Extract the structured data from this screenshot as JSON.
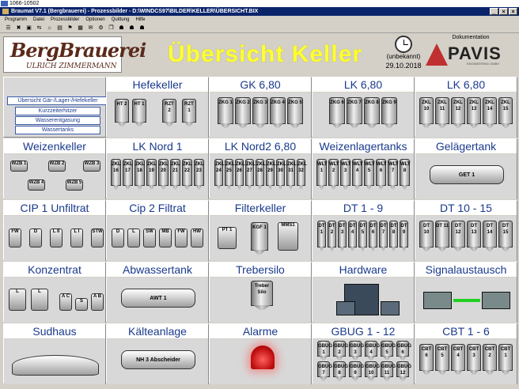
{
  "window": {
    "outer_title": "1066-10502",
    "title": "Braumat V7.1 (Bergbrauerei) - Prozessbilder - D:\\WINDCS97\\BILDER\\KELLER\\ÜBERSICHT.BIX",
    "controls": [
      "_",
      "×",
      "×"
    ]
  },
  "menu": [
    "Programm",
    "Datei",
    "Prozessbilder",
    "Optionen",
    "Quittung",
    "Hilfe"
  ],
  "toolbar_icons": [
    "☰",
    "✖",
    "▣",
    "⇆",
    "⌂",
    "▤",
    "⚑",
    "▦",
    "✉",
    "⚙",
    "❐",
    "☗",
    "☗",
    "☗"
  ],
  "header": {
    "logo_main": "BergBrauerei",
    "logo_sub": "ULRICH ZIMMERMANN",
    "page_title": "Übersicht Keller",
    "clock_label": "(unbekannt)",
    "date": "29.10.2018",
    "doc_label": "Dokumentation",
    "brand": "PAVIS",
    "brand_sub": "ENGINEERING GMBH"
  },
  "nav_buttons": [
    "Übersicht Gär-/Lager-/Hefekeller",
    "Kurzzeiterhitzer",
    "Wasserentgasung",
    "Wassertanks"
  ],
  "cells": {
    "hefekeller": {
      "title": "Hefekeller",
      "tanks": [
        "HT 2",
        "HT 1",
        "RZT 2",
        "RZT 1"
      ]
    },
    "gk": {
      "title": "GK 6,80",
      "tanks": [
        "ZKG 1",
        "ZKG 2",
        "ZKG 3",
        "ZKG 4",
        "ZKG 5"
      ]
    },
    "lk1": {
      "title": "LK 6,80",
      "tanks": [
        "ZKG 6",
        "ZKG 7",
        "ZKG 8",
        "ZKG 9"
      ]
    },
    "lk2": {
      "title": "LK 6,80",
      "tanks": [
        "ZKL 10",
        "ZKL 11",
        "ZKL 12",
        "ZKL 13",
        "ZKL 14",
        "ZKL 15"
      ]
    },
    "weizenkeller": {
      "title": "Weizenkeller",
      "tanks": [
        "WZB 1",
        "WZB 2",
        "WZB 3",
        "WZB 4",
        "WZB 5"
      ]
    },
    "lknord1": {
      "title": "LK Nord 1",
      "tanks": [
        "ZKL 16",
        "ZKL 17",
        "ZKL 18",
        "ZKL 19",
        "ZKL 20",
        "ZKL 21",
        "ZKL 22",
        "ZKL 23"
      ]
    },
    "lknord2": {
      "title": "LK Nord2  6,80",
      "tanks": [
        "ZKL 24",
        "ZKL 25",
        "ZKL 26",
        "ZKL 27",
        "ZKL 28",
        "ZKL 29",
        "ZKL 30",
        "ZKL 31",
        "ZKL 32"
      ]
    },
    "weizenlager": {
      "title": "Weizenlagertanks",
      "tanks": [
        "WLT 1",
        "WLT 2",
        "WLT 3",
        "WLT 4",
        "WLT 5",
        "WLT 6",
        "WLT 7",
        "WLT 8"
      ]
    },
    "gelaeger": {
      "title": "Gelägertank",
      "tanks": [
        "GET 1"
      ]
    },
    "cip1": {
      "title": "CIP 1 Unfiltrat",
      "tanks": [
        "FW",
        "D",
        "L II",
        "L I",
        "STW"
      ]
    },
    "cip2": {
      "title": "Cip 2 Filtrat",
      "tanks": [
        "D",
        "L",
        "SW",
        "MB",
        "FW",
        "HW"
      ]
    },
    "filterkeller": {
      "title": "Filterkeller",
      "tanks": [
        "PT 1",
        "KGF 1",
        "MMS1"
      ]
    },
    "dt19": {
      "title": "DT 1 - 9",
      "tanks": [
        "DT 1",
        "DT 2",
        "DT 3",
        "DT 4",
        "DT 5",
        "DT 6",
        "DT 7",
        "DT 8",
        "DT 9"
      ]
    },
    "dt1015": {
      "title": "DT 10 - 15",
      "tanks": [
        "DT 10",
        "DT 11",
        "DT 12",
        "DT 13",
        "DT 14",
        "DT 15"
      ]
    },
    "konzentrat": {
      "title": "Konzentrat",
      "tanks": [
        "L",
        "L",
        "A C",
        "S",
        "A B"
      ]
    },
    "abwasser": {
      "title": "Abwassertank",
      "tanks": [
        "AWT 1"
      ]
    },
    "treber": {
      "title": "Trebersilo",
      "tanks": [
        "Treber Silo"
      ]
    },
    "hardware": {
      "title": "Hardware"
    },
    "signal": {
      "title": "Signalaustausch"
    },
    "sudhaus": {
      "title": "Sudhaus"
    },
    "kaelte": {
      "title": "Kälteanlage",
      "tanks": [
        "NH 3 Abscheider"
      ]
    },
    "alarme": {
      "title": "Alarme"
    },
    "gbug": {
      "title": "GBUG 1 - 12",
      "tanks": [
        "GBUG 1",
        "GBUG 2",
        "GBUG 3",
        "GBUG 4",
        "GBUG 5",
        "GBUG 6",
        "GBUG 7",
        "GBUG 8",
        "GBUG 9",
        "GBUG 10",
        "GBUG 11",
        "GBUG 12"
      ]
    },
    "cbt": {
      "title": "CBT 1 - 6",
      "tanks": [
        "CBT 6",
        "CBT 5",
        "CBT 4",
        "CBT 3",
        "CBT 2",
        "CBT 1"
      ]
    }
  }
}
